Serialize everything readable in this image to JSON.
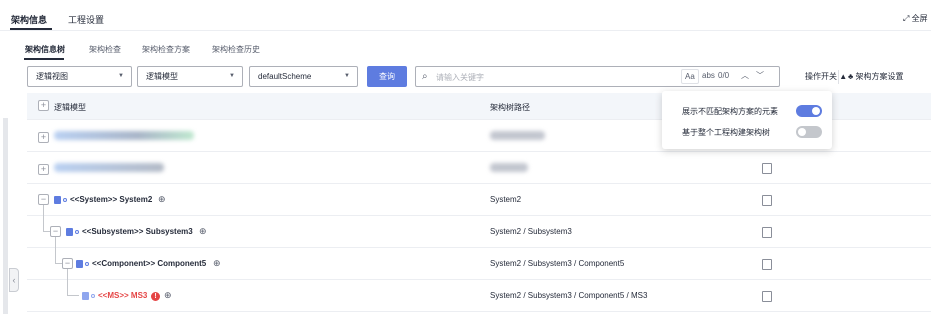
{
  "top_tabs": [
    {
      "label": "架构信息",
      "active": true
    },
    {
      "label": "工程设置",
      "active": false
    }
  ],
  "fullscreen_label": "全屏",
  "sub_tabs": [
    {
      "label": "架构信息树",
      "active": true
    },
    {
      "label": "架构检查",
      "active": false
    },
    {
      "label": "架构检查方案",
      "active": false
    },
    {
      "label": "架构检查历史",
      "active": false
    }
  ],
  "toolbar": {
    "view_select": "逻辑视图",
    "model_select": "逻辑模型",
    "scheme_select": "defaultScheme",
    "query_button": "查询",
    "search_placeholder": "请输入关键字",
    "match_case": "Aa",
    "abs": "abs",
    "result_count": "0/0",
    "ops_switch": "操作开关",
    "arch_settings": "架构方案设置"
  },
  "table": {
    "col_model": "逻辑模型",
    "col_path": "架构树路径",
    "rows": [
      {
        "name": "",
        "path": "",
        "blurred": true
      },
      {
        "name": "",
        "path": "",
        "blurred": true
      },
      {
        "name": "<<System>> System2",
        "path": "System2",
        "error": false
      },
      {
        "name": "<<Subsystem>> Subsystem3",
        "path": "System2 / Subsystem3",
        "error": false
      },
      {
        "name": "<<Component>> Component5",
        "path": "System2 / Subsystem3 / Component5",
        "error": false
      },
      {
        "name": "<<MS>> MS3",
        "path": "System2 / Subsystem3 / Component5 / MS3",
        "error": true,
        "error_mark": "!"
      }
    ]
  },
  "popup": {
    "option1_label": "展示不匹配架构方案的元素",
    "option1_on": true,
    "option2_label": "基于整个工程构建架构树",
    "option2_on": false
  },
  "colors": {
    "primary": "#5e7ce0",
    "error": "#e54545",
    "toggle_off": "#c4c7cc"
  }
}
